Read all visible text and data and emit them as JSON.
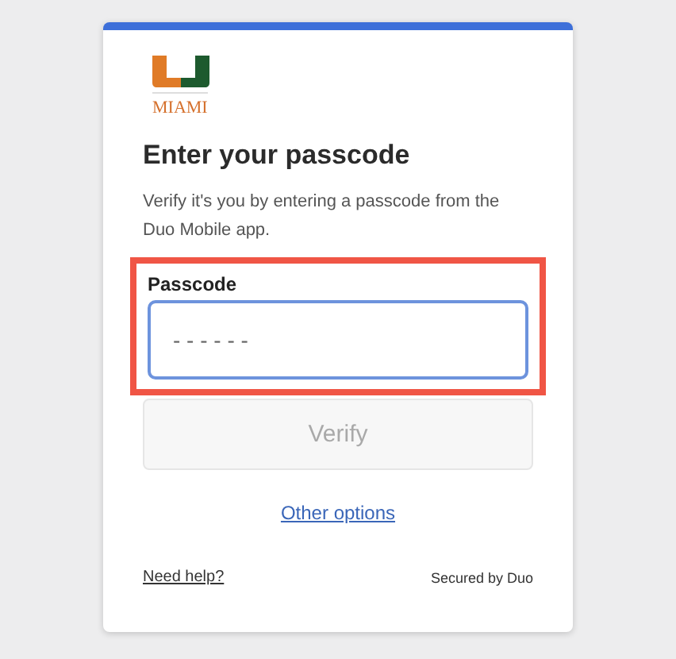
{
  "logo": {
    "text": "MIAMI"
  },
  "heading": "Enter your passcode",
  "description": "Verify it's you by entering a passcode from the Duo Mobile app.",
  "passcode": {
    "label": "Passcode",
    "placeholder": "- - - - - -",
    "highlighted": true,
    "focused": true
  },
  "verify_button": {
    "label": "Verify",
    "disabled": true
  },
  "other_options": "Other options",
  "footer": {
    "help_link": "Need help?",
    "secured_by": "Secured by Duo"
  }
}
